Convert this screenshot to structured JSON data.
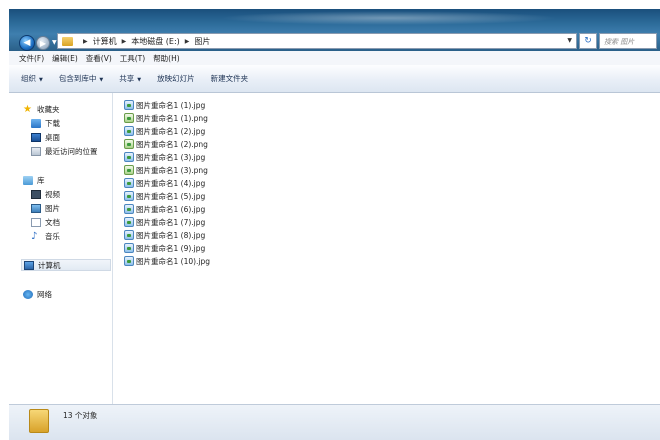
{
  "address": {
    "crumbs": [
      "计算机",
      "本地磁盘 (E:)",
      "图片"
    ],
    "search_placeholder": "搜索 图片"
  },
  "menu": [
    "文件(F)",
    "编辑(E)",
    "查看(V)",
    "工具(T)",
    "帮助(H)"
  ],
  "commands": [
    {
      "label": "组织",
      "dropdown": true
    },
    {
      "label": "包含到库中",
      "dropdown": true
    },
    {
      "label": "共享",
      "dropdown": true
    },
    {
      "label": "放映幻灯片",
      "dropdown": false
    },
    {
      "label": "新建文件夹",
      "dropdown": false
    }
  ],
  "nav": {
    "favorites": "收藏夹",
    "downloads": "下载",
    "desktop": "桌面",
    "recent": "最近访问的位置",
    "libraries": "库",
    "videos": "视频",
    "pictures": "图片",
    "documents": "文档",
    "music": "音乐",
    "computer": "计算机",
    "network": "网络"
  },
  "files": [
    {
      "name": "图片重命名1 (1).jpg",
      "type": "jpg"
    },
    {
      "name": "图片重命名1 (1).png",
      "type": "png"
    },
    {
      "name": "图片重命名1 (2).jpg",
      "type": "jpg"
    },
    {
      "name": "图片重命名1 (2).png",
      "type": "png"
    },
    {
      "name": "图片重命名1 (3).jpg",
      "type": "jpg"
    },
    {
      "name": "图片重命名1 (3).png",
      "type": "png"
    },
    {
      "name": "图片重命名1 (4).jpg",
      "type": "jpg"
    },
    {
      "name": "图片重命名1 (5).jpg",
      "type": "jpg"
    },
    {
      "name": "图片重命名1 (6).jpg",
      "type": "jpg"
    },
    {
      "name": "图片重命名1 (7).jpg",
      "type": "jpg"
    },
    {
      "name": "图片重命名1 (8).jpg",
      "type": "jpg"
    },
    {
      "name": "图片重命名1 (9).jpg",
      "type": "jpg"
    },
    {
      "name": "图片重命名1 (10).jpg",
      "type": "jpg"
    }
  ],
  "status": {
    "count_text": "13 个对象"
  }
}
